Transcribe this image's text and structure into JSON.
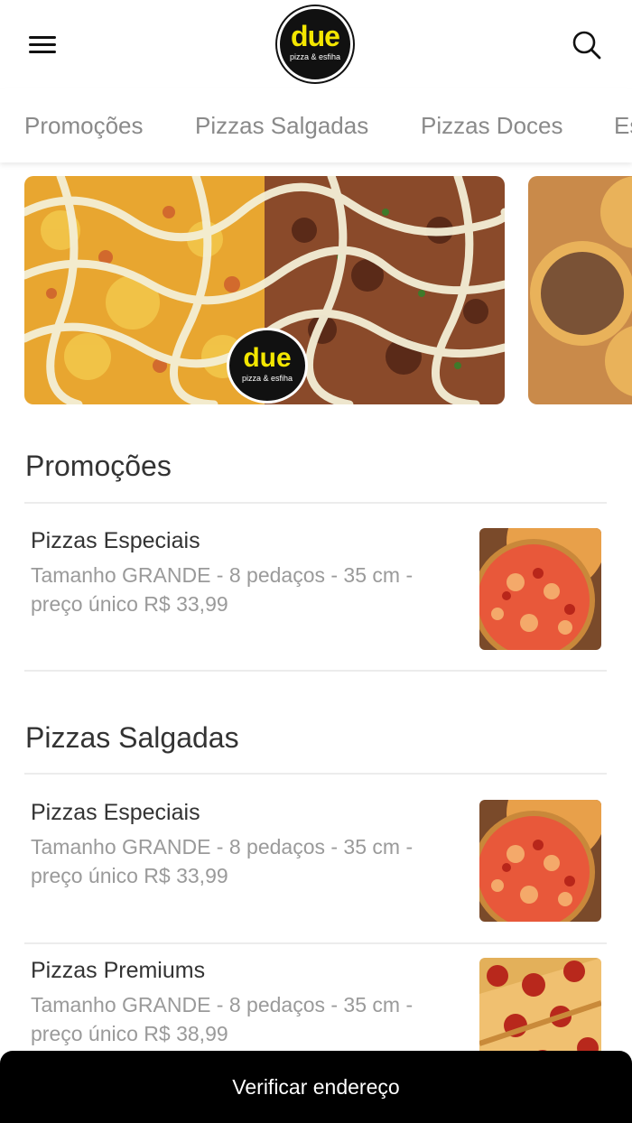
{
  "header": {
    "logo_main": "due",
    "logo_sub": "pizza & esfiha"
  },
  "tabs": [
    {
      "label": "Promoções"
    },
    {
      "label": "Pizzas Salgadas"
    },
    {
      "label": "Pizzas Doces"
    },
    {
      "label": "Es"
    }
  ],
  "banner": {
    "logo_main": "due",
    "logo_sub": "pizza & esfiha"
  },
  "sections": [
    {
      "title": "Promoções",
      "items": [
        {
          "name": "Pizzas Especiais",
          "desc": "Tamanho GRANDE - 8 pedaços - 35 cm - preço único R$ 33,99"
        }
      ]
    },
    {
      "title": "Pizzas Salgadas",
      "items": [
        {
          "name": "Pizzas Especiais",
          "desc": "Tamanho GRANDE - 8 pedaços - 35 cm - preço único R$ 33,99"
        },
        {
          "name": "Pizzas Premiums",
          "desc": "Tamanho GRANDE - 8 pedaços - 35 cm - preço único R$ 38,99"
        }
      ]
    }
  ],
  "footer": {
    "button_label": "Verificar endereço"
  },
  "colors": {
    "brand_yellow": "#f3e600",
    "footer_bg": "#000000",
    "tab_text": "#8a8a8a"
  },
  "icons": [
    "hamburger-menu-icon",
    "search-icon"
  ]
}
